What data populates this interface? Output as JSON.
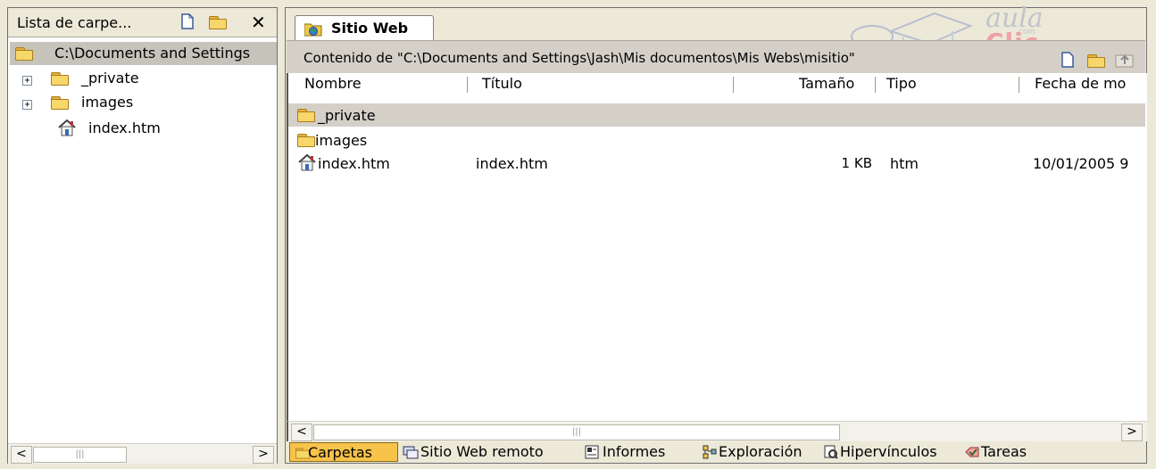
{
  "left_panel": {
    "title": "Lista de carpe...",
    "tree": [
      {
        "label": "C:\\Documents and Settings"
      },
      {
        "label": "_private"
      },
      {
        "label": "images"
      },
      {
        "label": "index.htm"
      }
    ]
  },
  "tab": {
    "label": "Sitio Web"
  },
  "path_bar": {
    "text": "Contenido de \"C:\\Documents and Settings\\Jash\\Mis documentos\\Mis Webs\\misitio\""
  },
  "columns": [
    "Nombre",
    "Título",
    "Tamaño",
    "Tipo",
    "Fecha de mo"
  ],
  "rows": [
    {
      "name": "_private",
      "title": "",
      "size": "",
      "type": "",
      "date": ""
    },
    {
      "name": "images",
      "title": "",
      "size": "",
      "type": "",
      "date": ""
    },
    {
      "name": "index.htm",
      "title": "index.htm",
      "size": "1 KB",
      "type": "htm",
      "date": "10/01/2005 9"
    }
  ],
  "bottom_views": [
    {
      "label": "Carpetas",
      "icon": "folder-icon"
    },
    {
      "label": "Sitio Web remoto",
      "icon": "remote-site-icon"
    },
    {
      "label": "Informes",
      "icon": "reports-icon"
    },
    {
      "label": "Exploración",
      "icon": "navigation-icon"
    },
    {
      "label": "Hipervínculos",
      "icon": "hyperlinks-icon"
    },
    {
      "label": "Tareas",
      "icon": "tasks-icon"
    }
  ],
  "logo": {
    "top": "aula",
    "bottom": "Clic",
    "small": ".com"
  },
  "colors": {
    "selected_row": "#d4d0c8",
    "active_view": "#f7c34a",
    "panel_border": "#808080"
  }
}
